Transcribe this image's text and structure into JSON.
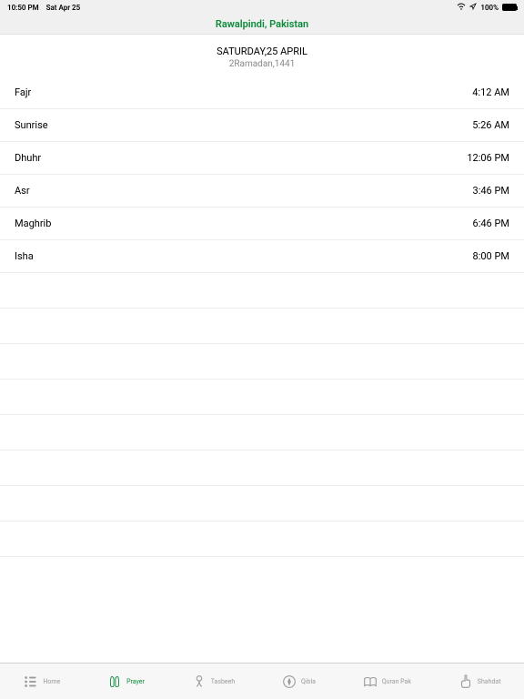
{
  "statusBar": {
    "time": "10:50 PM",
    "date": "Sat Apr 25",
    "battery": "100%"
  },
  "header": {
    "location": "Rawalpindi, Pakistan"
  },
  "dateSection": {
    "mainDate": "SATURDAY,25 APRIL",
    "islamicDate": "2Ramadan,1441"
  },
  "prayers": [
    {
      "name": "Fajr",
      "time": "4:12 AM"
    },
    {
      "name": "Sunrise",
      "time": "5:26 AM"
    },
    {
      "name": "Dhuhr",
      "time": "12:06 PM"
    },
    {
      "name": "Asr",
      "time": "3:46 PM"
    },
    {
      "name": "Maghrib",
      "time": "6:46 PM"
    },
    {
      "name": "Isha",
      "time": "8:00 PM"
    }
  ],
  "tabs": [
    {
      "label": "Home",
      "icon": "list"
    },
    {
      "label": "Prayer",
      "icon": "hands",
      "active": true
    },
    {
      "label": "Tasbeeh",
      "icon": "beads"
    },
    {
      "label": "Qibla",
      "icon": "compass"
    },
    {
      "label": "Quran Pak",
      "icon": "book"
    },
    {
      "label": "Shahdat",
      "icon": "finger"
    }
  ]
}
